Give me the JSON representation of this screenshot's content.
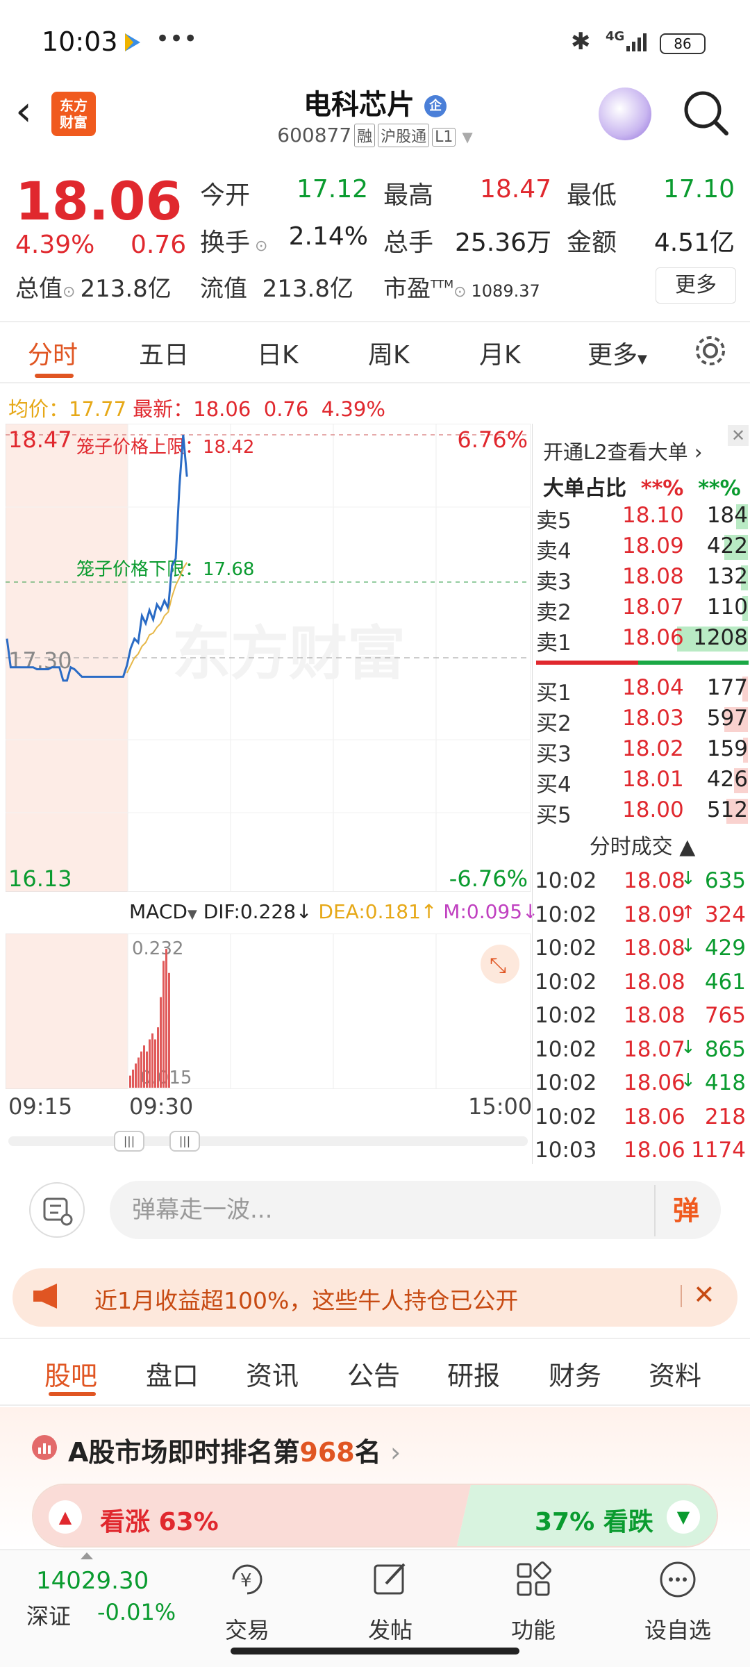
{
  "status": {
    "time": "10:03",
    "battery": "86",
    "network": "4G"
  },
  "header": {
    "logo": "东方财富",
    "title": "电科芯片",
    "code": "600877",
    "tags": [
      "融",
      "沪股通",
      "L1"
    ],
    "badge": "企"
  },
  "quote": {
    "price": "18.06",
    "pct": "4.39%",
    "change": "0.76",
    "rows": [
      [
        {
          "label": "今开",
          "value": "17.12",
          "color": "green"
        },
        {
          "label": "最高",
          "value": "18.47",
          "color": "red"
        },
        {
          "label": "最低",
          "value": "17.10",
          "color": "green"
        }
      ],
      [
        {
          "label": "换手",
          "value": "2.14%",
          "color": "dark"
        },
        {
          "label": "总手",
          "value": "25.36万",
          "color": "dark"
        },
        {
          "label": "金额",
          "value": "4.51亿",
          "color": "dark"
        }
      ]
    ],
    "total_cap_label": "总值",
    "total_cap": "213.8亿",
    "float_cap_label": "流值",
    "float_cap": "213.8亿",
    "pe_label": "市盈",
    "pe_sup": "TTM",
    "pe": "1089.37",
    "more": "更多"
  },
  "tabs": [
    "分时",
    "五日",
    "日K",
    "周K",
    "月K",
    "更多"
  ],
  "avg_line": {
    "avg_label": "均价：",
    "avg": "17.77",
    "latest_label": "最新：",
    "latest": "18.06",
    "change": "0.76",
    "pct": "4.39%"
  },
  "chart_data": {
    "type": "line",
    "y_top": "18.47",
    "y_mid": "17.30",
    "y_bottom": "16.13",
    "pct_top": "6.76%",
    "pct_bottom": "-6.76%",
    "upper_limit_label": "笼子价格上限：18.42",
    "lower_limit_label": "笼子价格下限：17.68",
    "ylim": [
      16.13,
      18.47
    ],
    "x_ticks": [
      "09:15",
      "09:30",
      "15:00"
    ],
    "watermark": "东方财富",
    "series": [
      {
        "values": [
          17.4,
          17.25,
          17.25,
          17.25,
          17.25,
          17.25,
          17.25,
          17.25,
          17.24,
          17.24,
          17.24,
          17.24,
          17.25,
          17.25,
          17.25,
          17.18,
          17.18,
          17.25,
          17.24,
          17.22,
          17.2,
          17.2,
          17.2,
          17.2,
          17.2,
          17.2,
          17.2,
          17.2,
          17.2,
          17.2,
          17.2,
          17.2,
          17.26,
          17.35,
          17.4,
          17.38,
          17.52,
          17.48,
          17.55,
          17.5,
          17.58,
          17.55,
          17.6,
          17.56,
          17.78,
          17.82,
          18.2,
          18.47,
          18.25
        ]
      },
      {
        "values": [
          null,
          null,
          null,
          null,
          null,
          null,
          null,
          null,
          null,
          null,
          null,
          null,
          null,
          null,
          null,
          null,
          null,
          null,
          null,
          null,
          null,
          null,
          null,
          null,
          null,
          null,
          null,
          null,
          null,
          null,
          null,
          null,
          17.22,
          17.26,
          17.3,
          17.32,
          17.36,
          17.38,
          17.42,
          17.43,
          17.46,
          17.48,
          17.52,
          17.54,
          17.62,
          17.68,
          17.72,
          17.77,
          17.8
        ]
      }
    ]
  },
  "macd": {
    "label": "MACD",
    "dif": "DIF:0.228",
    "dea": "DEA:0.181",
    "m": "M:0.095",
    "top_val": "0.232",
    "low_val": "0.015",
    "bars": [
      0.02,
      0.03,
      0.04,
      0.05,
      0.06,
      0.07,
      0.06,
      0.08,
      0.09,
      0.08,
      0.1,
      0.15,
      0.21,
      0.23,
      0.19
    ]
  },
  "orderbook": {
    "l2_link": "开通L2查看大单",
    "big_order_label": "大单占比",
    "big_red": "**%",
    "big_green": "**%",
    "asks": [
      {
        "label": "卖5",
        "price": "18.10",
        "vol": "184",
        "bar": 0.1
      },
      {
        "label": "卖4",
        "price": "18.09",
        "vol": "422",
        "bar": 0.2
      },
      {
        "label": "卖3",
        "price": "18.08",
        "vol": "132",
        "bar": 0.06
      },
      {
        "label": "卖2",
        "price": "18.07",
        "vol": "110",
        "bar": 0.05
      },
      {
        "label": "卖1",
        "price": "18.06",
        "vol": "1208",
        "bar": 0.6
      }
    ],
    "bids": [
      {
        "label": "买1",
        "price": "18.04",
        "vol": "177",
        "bar": 0.05
      },
      {
        "label": "买2",
        "price": "18.03",
        "vol": "597",
        "bar": 0.2
      },
      {
        "label": "买3",
        "price": "18.02",
        "vol": "159",
        "bar": 0.04
      },
      {
        "label": "买4",
        "price": "18.01",
        "vol": "426",
        "bar": 0.12
      },
      {
        "label": "买5",
        "price": "18.00",
        "vol": "512",
        "bar": 0.18
      }
    ],
    "trades_title": "分时成交",
    "trades": [
      {
        "time": "10:02",
        "price": "18.08",
        "arrow": "↓",
        "vol": "635",
        "pc": "red",
        "vc": "green"
      },
      {
        "time": "10:02",
        "price": "18.09",
        "arrow": "↑",
        "vol": "324",
        "pc": "red",
        "vc": "red"
      },
      {
        "time": "10:02",
        "price": "18.08",
        "arrow": "↓",
        "vol": "429",
        "pc": "red",
        "vc": "green"
      },
      {
        "time": "10:02",
        "price": "18.08",
        "arrow": "",
        "vol": "461",
        "pc": "red",
        "vc": "green"
      },
      {
        "time": "10:02",
        "price": "18.08",
        "arrow": "",
        "vol": "765",
        "pc": "red",
        "vc": "red"
      },
      {
        "time": "10:02",
        "price": "18.07",
        "arrow": "↓",
        "vol": "865",
        "pc": "red",
        "vc": "green"
      },
      {
        "time": "10:02",
        "price": "18.06",
        "arrow": "↓",
        "vol": "418",
        "pc": "red",
        "vc": "green"
      },
      {
        "time": "10:02",
        "price": "18.06",
        "arrow": "",
        "vol": "218",
        "pc": "red",
        "vc": "red"
      },
      {
        "time": "10:03",
        "price": "18.06",
        "arrow": "",
        "vol": "1174",
        "pc": "red",
        "vc": "red"
      }
    ]
  },
  "danmu": {
    "placeholder": "弹幕走一波...",
    "send": "弹"
  },
  "banner": {
    "text": "近1月收益超100%，这些牛人持仓已公开"
  },
  "bottom_tabs": [
    "股吧",
    "盘口",
    "资讯",
    "公告",
    "研报",
    "财务",
    "资料"
  ],
  "rank": {
    "prefix": "A股市场即时排名第",
    "num": "968",
    "suffix": "名"
  },
  "vote": {
    "up_label": "看涨",
    "up_pct": "63%",
    "down_label": "看跌",
    "down_pct": "37%",
    "up_share": 0.63
  },
  "nav": {
    "index_value": "14029.30",
    "index_name": "深证",
    "index_change": "-0.01%",
    "items": [
      "交易",
      "发帖",
      "功能",
      "设自选"
    ]
  },
  "colors": {
    "red": "#e0282e",
    "green": "#0a9b2f",
    "accent": "#e05522"
  }
}
